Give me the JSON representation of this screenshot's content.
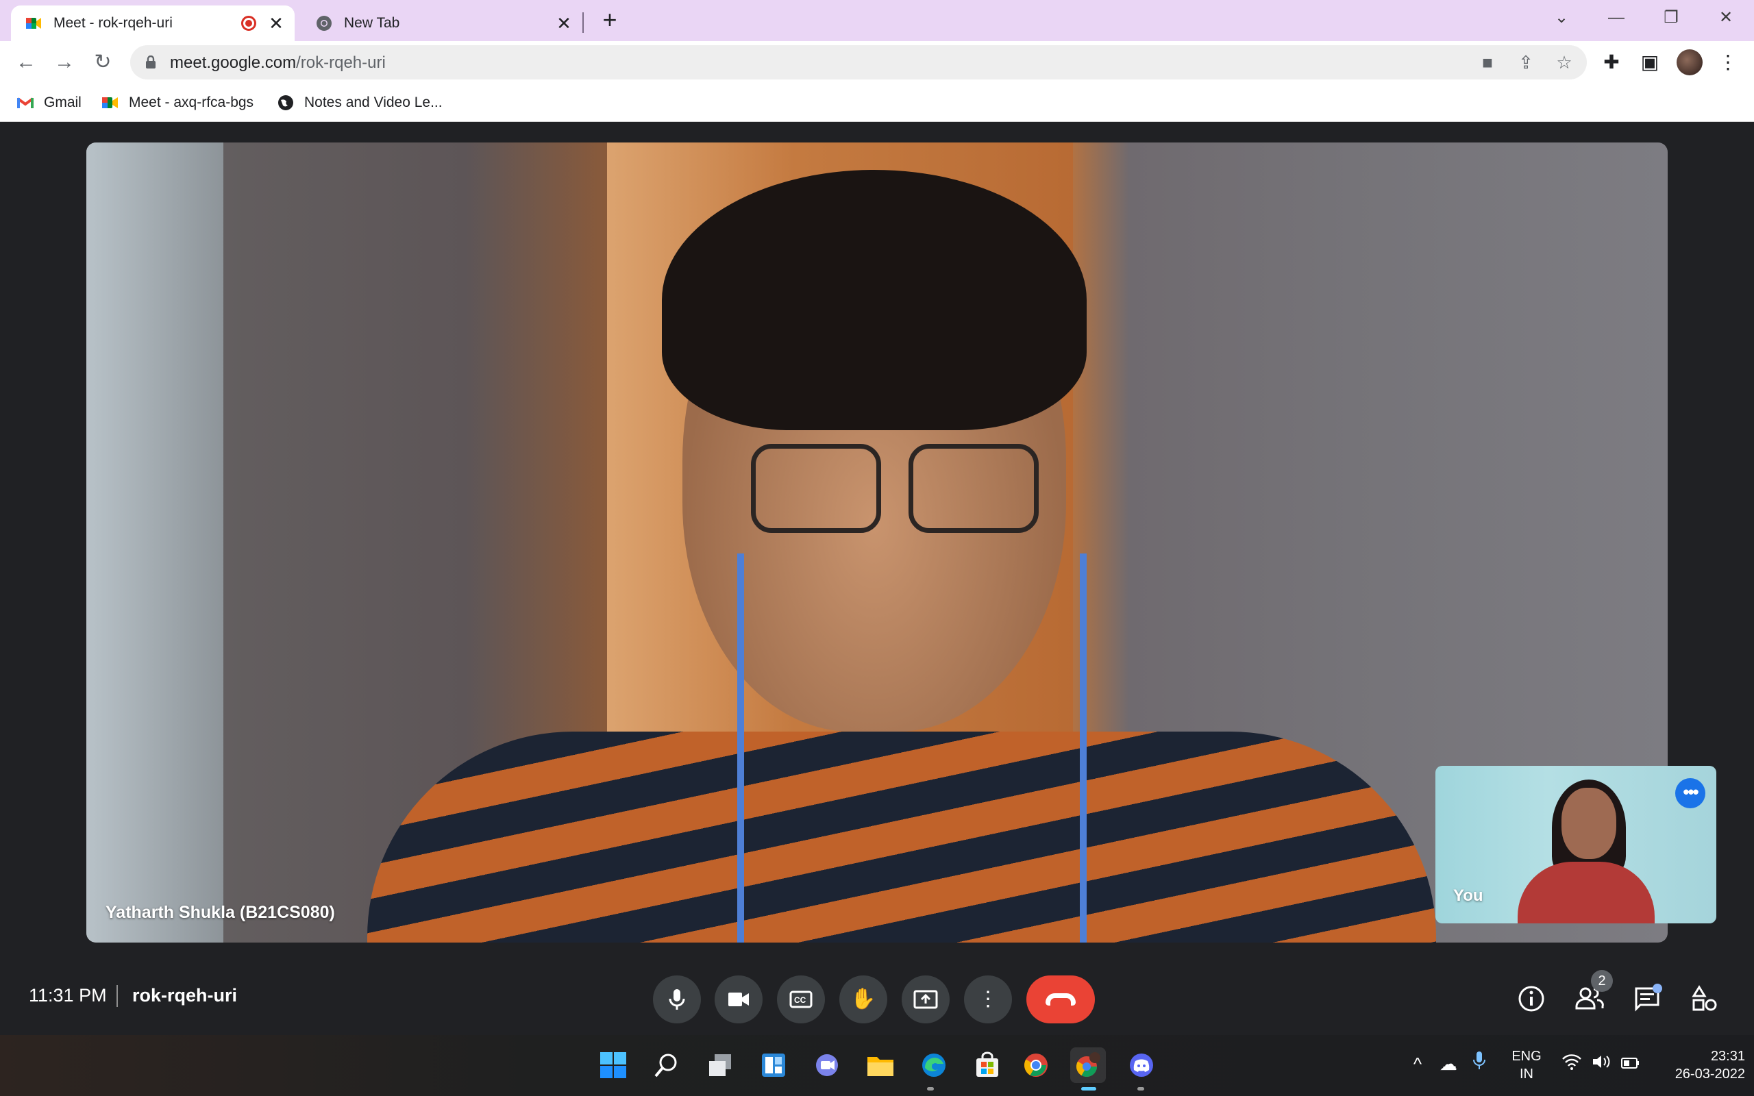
{
  "browser": {
    "tabs": [
      {
        "title": "Meet - rok-rqeh-uri",
        "favicon": "google-meet-icon",
        "recording": true,
        "active": true
      },
      {
        "title": "New Tab",
        "favicon": "chrome-icon",
        "active": false
      }
    ],
    "url_domain": "meet.google.com",
    "url_path": "/rok-rqeh-uri",
    "bookmarks": [
      {
        "label": "Gmail",
        "icon": "gmail-icon"
      },
      {
        "label": "Meet - axq-rfca-bgs",
        "icon": "google-meet-icon"
      },
      {
        "label": "Notes and Video Le...",
        "icon": "globe-icon"
      }
    ]
  },
  "meet": {
    "main_participant": "Yatharth Shukla (B21CS080)",
    "self_label": "You",
    "time": "11:31 PM",
    "meeting_code": "rok-rqeh-uri",
    "people_count": "2",
    "controls": [
      "mic-icon",
      "camera-icon",
      "captions-icon",
      "raise-hand-icon",
      "present-icon",
      "more-options-icon",
      "end-call-icon"
    ],
    "right_controls": [
      "info-icon",
      "people-icon",
      "chat-icon",
      "activities-icon"
    ],
    "colors": {
      "end_call": "#ea4335",
      "self_more": "#1a73e8",
      "background": "#202124"
    }
  },
  "taskbar": {
    "apps": [
      "windows-start-icon",
      "search-icon",
      "task-view-icon",
      "widgets-icon",
      "teams-chat-icon",
      "file-explorer-icon",
      "edge-icon",
      "store-icon",
      "chrome-icon",
      "chrome-profile-icon",
      "discord-icon"
    ],
    "language_line1": "ENG",
    "language_line2": "IN",
    "clock_time": "23:31",
    "clock_date": "26-03-2022"
  }
}
